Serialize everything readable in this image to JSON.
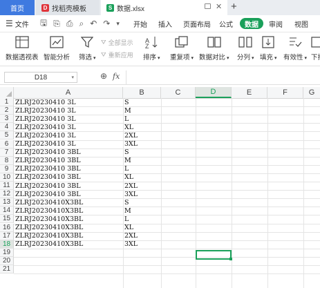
{
  "tabs": [
    {
      "label": "首页"
    },
    {
      "label": "找稻壳模板"
    },
    {
      "label": "数据.xlsx"
    }
  ],
  "window_controls": {
    "add": "+"
  },
  "menu": {
    "file": "文件",
    "items": [
      "开始",
      "插入",
      "页面布局",
      "公式",
      "数据",
      "审阅",
      "视图"
    ]
  },
  "ribbon": {
    "pivot": "数据透视表",
    "smart": "智能分析",
    "filter": "筛选",
    "show_all": "全部显示",
    "reapply": "重新应用",
    "sort": "排序",
    "duplicates": "重复项",
    "compare": "数据对比",
    "split": "分列",
    "fill": "填充",
    "validity": "有效性",
    "dropdown": "下拉"
  },
  "formula_bar": {
    "name_box": "D18",
    "fx": "fx"
  },
  "columns": [
    "A",
    "B",
    "C",
    "D",
    "E",
    "F",
    "G"
  ],
  "rows": [
    {
      "n": "1",
      "a": "ZLRJ20230410 3L",
      "b": "S"
    },
    {
      "n": "2",
      "a": "ZLRJ20230410 3L",
      "b": "M"
    },
    {
      "n": "3",
      "a": "ZLRJ20230410 3L",
      "b": "L"
    },
    {
      "n": "4",
      "a": "ZLRJ20230410 3L",
      "b": "XL"
    },
    {
      "n": "5",
      "a": "ZLRJ20230410 3L",
      "b": "2XL"
    },
    {
      "n": "6",
      "a": "ZLRJ20230410 3L",
      "b": "3XL"
    },
    {
      "n": "7",
      "a": "ZLRJ20230410 3BL",
      "b": "S"
    },
    {
      "n": "8",
      "a": "ZLRJ20230410 3BL",
      "b": "M"
    },
    {
      "n": "9",
      "a": "ZLRJ20230410 3BL",
      "b": "L"
    },
    {
      "n": "10",
      "a": "ZLRJ20230410 3BL",
      "b": "XL"
    },
    {
      "n": "11",
      "a": "ZLRJ20230410 3BL",
      "b": "2XL"
    },
    {
      "n": "12",
      "a": "ZLRJ20230410 3BL",
      "b": "3XL"
    },
    {
      "n": "13",
      "a": "ZLRJ20230410X3BL",
      "b": "S"
    },
    {
      "n": "14",
      "a": "ZLRJ20230410X3BL",
      "b": "M"
    },
    {
      "n": "15",
      "a": "ZLRJ20230410X3BL",
      "b": "L"
    },
    {
      "n": "16",
      "a": "ZLRJ20230410X3BL",
      "b": "XL"
    },
    {
      "n": "17",
      "a": "ZLRJ20230410X3BL",
      "b": "2XL"
    },
    {
      "n": "18",
      "a": "ZLRJ20230410X3BL",
      "b": "3XL"
    },
    {
      "n": "19",
      "a": "",
      "b": ""
    },
    {
      "n": "20",
      "a": "",
      "b": ""
    },
    {
      "n": "21",
      "a": "",
      "b": ""
    }
  ],
  "colors": {
    "accent": "#1aa05a",
    "home_tab": "#3f7ae0",
    "selection": "#1aa05a"
  }
}
